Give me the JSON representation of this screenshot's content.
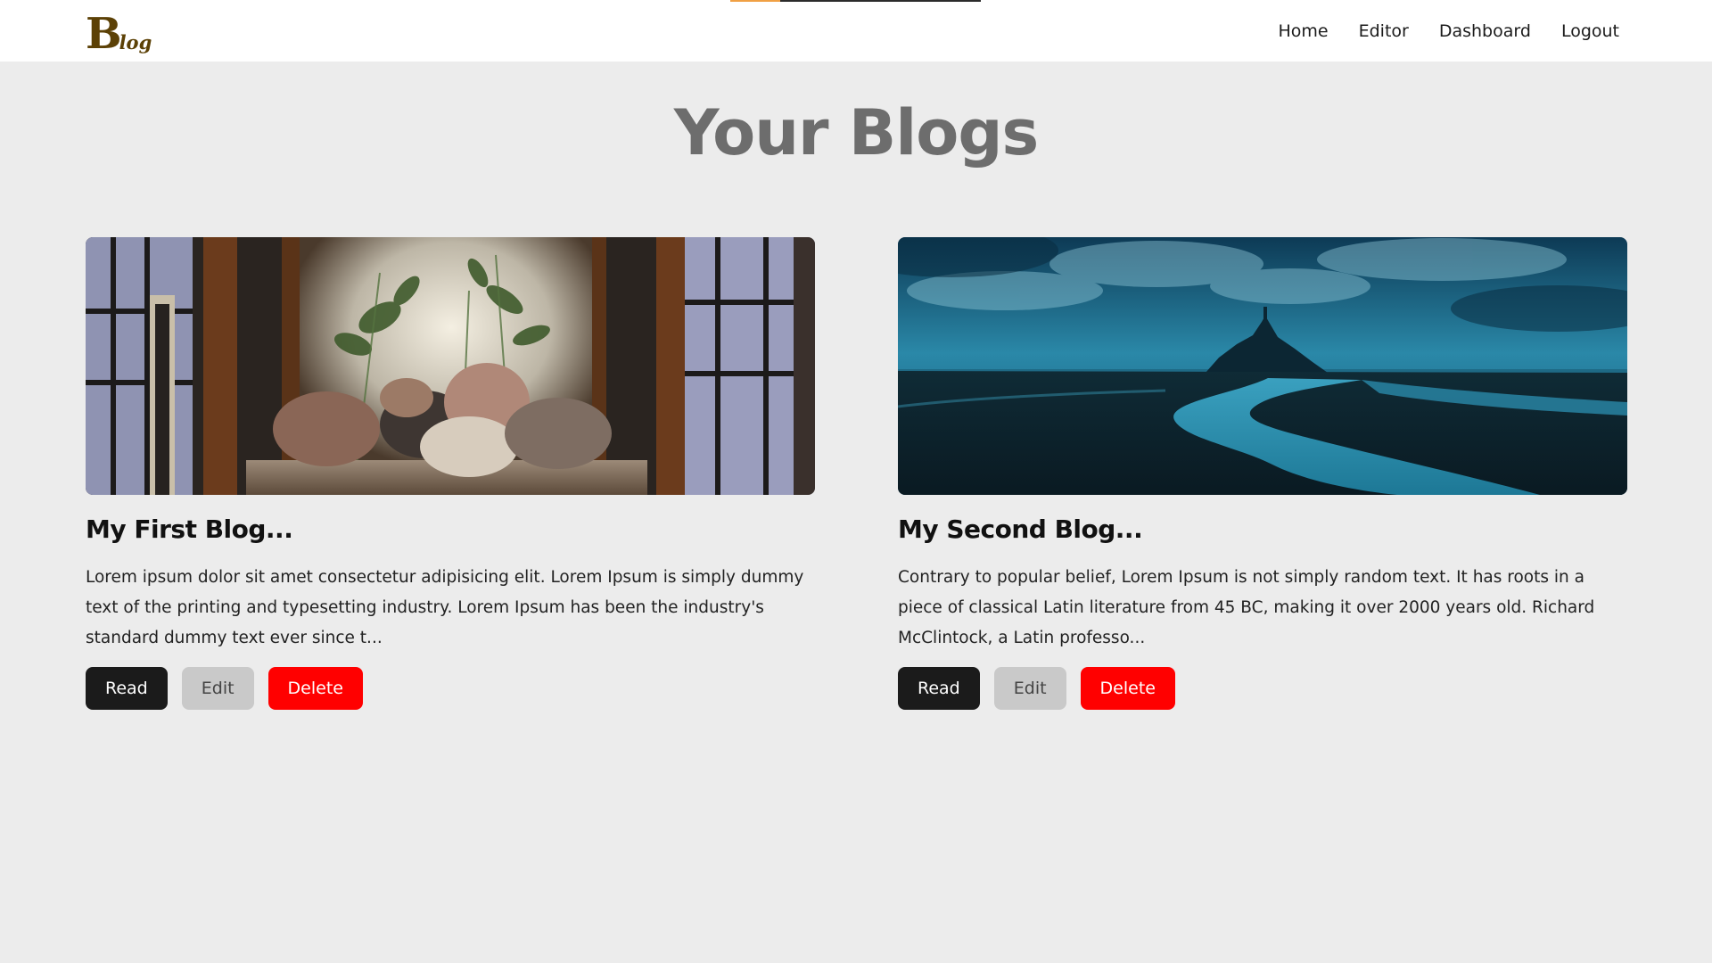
{
  "nav": {
    "logo": {
      "letter": "B",
      "rest": "log"
    },
    "links": [
      {
        "label": "Home"
      },
      {
        "label": "Editor"
      },
      {
        "label": "Dashboard"
      },
      {
        "label": "Logout"
      }
    ],
    "scroll_progress_percent": 20
  },
  "page": {
    "title": "Your Blogs"
  },
  "blogs": [
    {
      "title": "My First Blog...",
      "excerpt": "Lorem ipsum dolor sit amet consectetur adipisicing elit. Lorem Ipsum is simply dummy text of the printing and typesetting industry. Lorem Ipsum has been the industry's standard dummy text ever since t...",
      "image": "cozy-room-with-plants-and-pillows",
      "actions": {
        "read": "Read",
        "edit": "Edit",
        "delete": "Delete"
      }
    },
    {
      "title": "My Second Blog...",
      "excerpt": "Contrary to popular belief, Lorem Ipsum is not simply random text. It has roots in a piece of classical Latin literature from 45 BC, making it over 2000 years old. Richard McClintock, a Latin professo...",
      "image": "island-castle-at-dusk-with-river",
      "actions": {
        "read": "Read",
        "edit": "Edit",
        "delete": "Delete"
      }
    }
  ],
  "colors": {
    "background": "#ececec",
    "read_button": "#1b1b1b",
    "edit_button": "#c9c9c9",
    "delete_button": "#ff0000",
    "logo": "#5c4106",
    "progress": "#f0a044"
  }
}
